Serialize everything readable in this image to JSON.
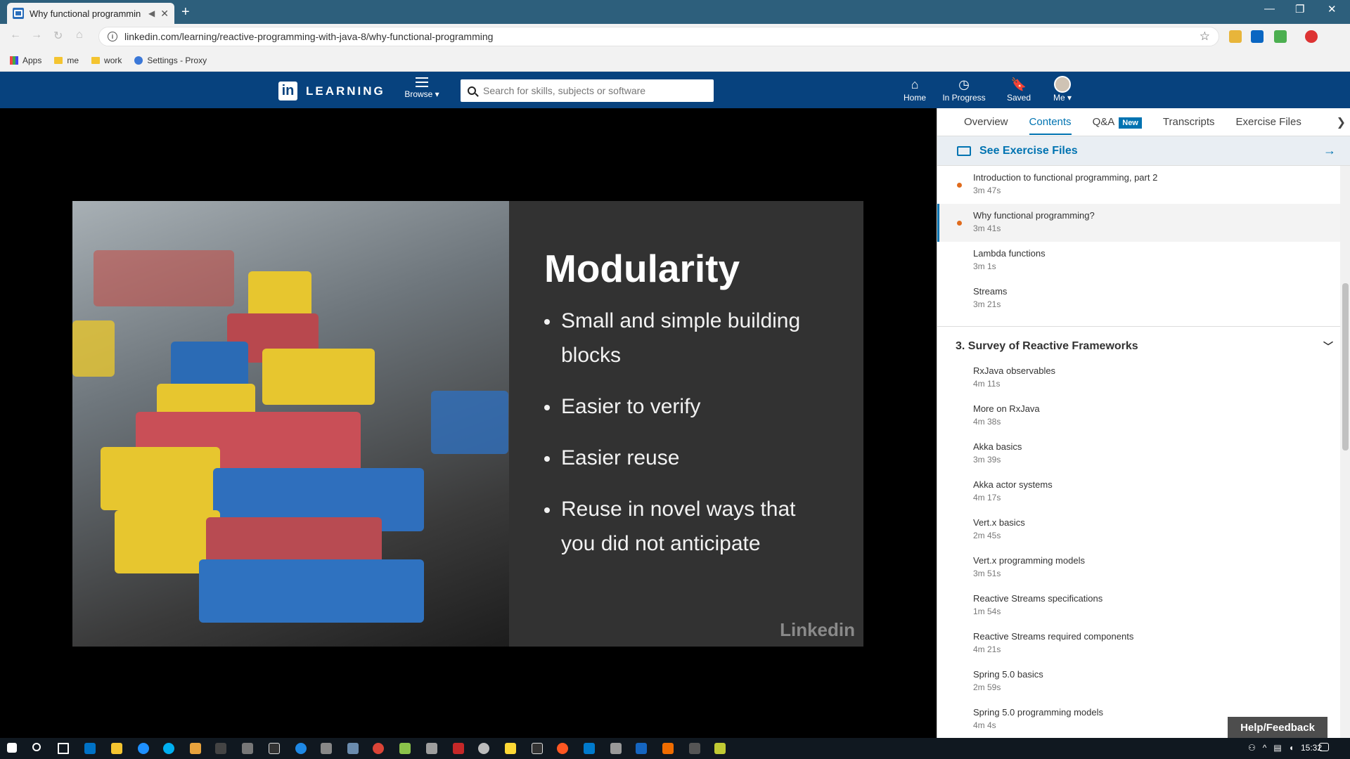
{
  "browser": {
    "tab_title": "Why functional programmin",
    "url": "linkedin.com/learning/reactive-programming-with-java-8/why-functional-programming",
    "bookmarks": [
      "Apps",
      "me",
      "work",
      "Settings - Proxy"
    ]
  },
  "header": {
    "logo_text": "LEARNING",
    "browse_label": "Browse",
    "search_placeholder": "Search for skills, subjects or software",
    "nav": {
      "home": "Home",
      "in_progress": "In Progress",
      "saved": "Saved",
      "me": "Me"
    }
  },
  "slide": {
    "title": "Modularity",
    "bullets": [
      "Small and simple building blocks",
      "Easier to verify",
      "Easier reuse",
      "Reuse in novel ways that you did not anticipate"
    ],
    "watermark": "Linkedin"
  },
  "panel": {
    "tabs": {
      "overview": "Overview",
      "contents": "Contents",
      "qa": "Q&A",
      "new_badge": "New",
      "transcripts": "Transcripts",
      "exercise": "Exercise Files"
    },
    "exercise_link": "See Exercise Files",
    "items": [
      {
        "name": "Introduction to functional programming, part 2",
        "dur": "3m 47s"
      },
      {
        "name": "Why functional programming?",
        "dur": "3m 41s"
      },
      {
        "name": "Lambda functions",
        "dur": "3m 1s"
      },
      {
        "name": "Streams",
        "dur": "3m 21s"
      }
    ],
    "section_title": "3. Survey of Reactive Frameworks",
    "section_items": [
      {
        "name": "RxJava observables",
        "dur": "4m 11s"
      },
      {
        "name": "More on RxJava",
        "dur": "4m 38s"
      },
      {
        "name": "Akka basics",
        "dur": "3m 39s"
      },
      {
        "name": "Akka actor systems",
        "dur": "4m 17s"
      },
      {
        "name": "Vert.x basics",
        "dur": "2m 45s"
      },
      {
        "name": "Vert.x programming models",
        "dur": "3m 51s"
      },
      {
        "name": "Reactive Streams specifications",
        "dur": "1m 54s"
      },
      {
        "name": "Reactive Streams required components",
        "dur": "4m 21s"
      },
      {
        "name": "Spring 5.0 basics",
        "dur": "2m 59s"
      },
      {
        "name": "Spring 5.0 programming models",
        "dur": "4m 4s"
      }
    ]
  },
  "help_feedback": "Help/Feedback",
  "taskbar": {
    "clock": "15:32"
  }
}
